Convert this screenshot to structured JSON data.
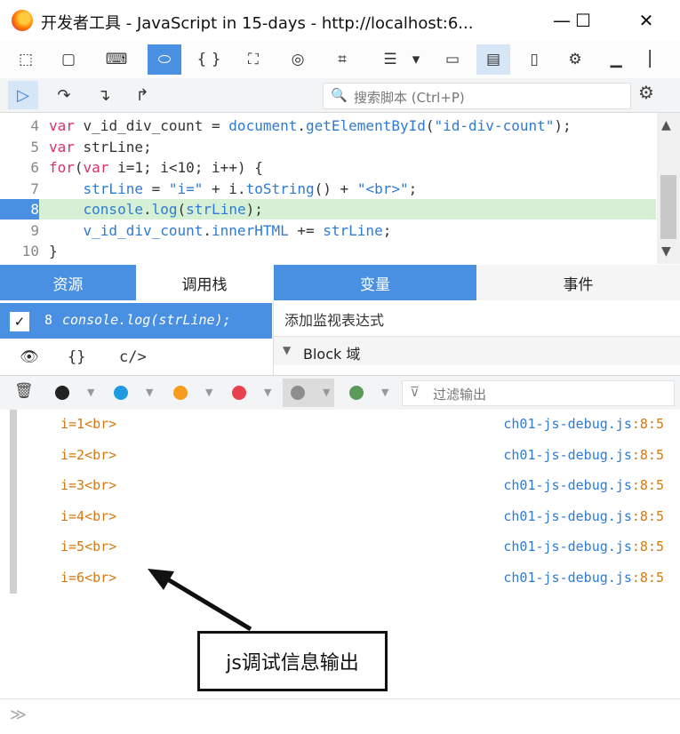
{
  "window": {
    "title": "开发者工具 - JavaScript in 15-days - http://localhost:6...",
    "minimize": "—",
    "maximize": "☐",
    "close": "✕"
  },
  "toolbar": {
    "icons": [
      "pick-element-icon",
      "responsive-icon",
      "console-icon",
      "debugger-icon",
      "style-editor-icon",
      "performance-icon",
      "network-icon",
      "storage-icon",
      "options-icon",
      "more-icon",
      "split-icon",
      "console-split-icon",
      "device-icon",
      "settings-icon",
      "dock-bottom-icon",
      "dock-side-icon"
    ],
    "glyphs": [
      "⬚",
      "▢",
      "⌨",
      "⬭",
      "{ }",
      "⛶",
      "◎",
      "⌗",
      "☰",
      "▾",
      "▭",
      "▤",
      "▯",
      "⚙",
      "▁",
      "▏"
    ]
  },
  "debugger": {
    "resume": "▷",
    "step_over": "↷",
    "step_in": "↴",
    "step_out": "↱",
    "search_placeholder": "搜索脚本 (Ctrl+P)",
    "search_icon": "🔍",
    "gear": "⚙"
  },
  "editor": {
    "lines": [
      {
        "n": "4",
        "parts": [
          [
            "kw",
            "var"
          ],
          [
            "pl",
            " v_id_div_count = "
          ],
          [
            "id",
            "document"
          ],
          [
            "pl",
            "."
          ],
          [
            "fn",
            "getElementById"
          ],
          [
            "pl",
            "("
          ],
          [
            "str",
            "\"id-div-count\""
          ],
          [
            "pl",
            ");"
          ]
        ]
      },
      {
        "n": "5",
        "parts": [
          [
            "kw",
            "var"
          ],
          [
            "pl",
            " strLine;"
          ]
        ]
      },
      {
        "n": "6",
        "parts": [
          [
            "kw",
            "for"
          ],
          [
            "pl",
            "("
          ],
          [
            "kw",
            "var"
          ],
          [
            "pl",
            " i=1; i<10; i++) {"
          ]
        ]
      },
      {
        "n": "7",
        "parts": [
          [
            "pl",
            "    "
          ],
          [
            "id",
            "strLine"
          ],
          [
            "pl",
            " = "
          ],
          [
            "str",
            "\"i=\""
          ],
          [
            "pl",
            " + i."
          ],
          [
            "fn",
            "toString"
          ],
          [
            "pl",
            "() + "
          ],
          [
            "str",
            "\"<br>\""
          ],
          [
            "pl",
            ";"
          ]
        ]
      },
      {
        "n": "8",
        "parts": [
          [
            "pl",
            "    "
          ],
          [
            "id",
            "console"
          ],
          [
            "pl",
            "."
          ],
          [
            "fn",
            "log"
          ],
          [
            "pl",
            "("
          ],
          [
            "id",
            "strLine"
          ],
          [
            "pl",
            ");"
          ]
        ]
      },
      {
        "n": "9",
        "parts": [
          [
            "pl",
            "    "
          ],
          [
            "id",
            "v_id_div_count"
          ],
          [
            "pl",
            "."
          ],
          [
            "fn",
            "innerHTML"
          ],
          [
            "pl",
            " += "
          ],
          [
            "id",
            "strLine"
          ],
          [
            "pl",
            ";"
          ]
        ]
      },
      {
        "n": "10",
        "parts": [
          [
            "pl",
            "}"
          ]
        ]
      }
    ],
    "current_line": "8",
    "scroll_up": "▲",
    "scroll_down": "▼"
  },
  "panes": {
    "tabs": [
      {
        "label": "资源"
      },
      {
        "label": "调用栈"
      },
      {
        "label": "变量"
      },
      {
        "label": "事件"
      }
    ],
    "stack": {
      "checked": "✓",
      "line": "8",
      "code": "console.log(strLine);",
      "eye": "👁",
      "braces": "{}",
      "tag": "c/>"
    },
    "vars": {
      "add_watch": "添加监视表达式",
      "scope_toggle": "▼",
      "scope_label": "Block 域"
    }
  },
  "console": {
    "trash": "🗑",
    "filter_placeholder": "过滤输出",
    "filter_icon": "⊽",
    "level_colors": [
      "#222222",
      "#1e9be0",
      "#f59b1d",
      "#e8414b",
      "#8e8e8e",
      "#5a9a5a"
    ],
    "messages": [
      {
        "text": "i=1<br>",
        "file": "ch01-js-debug.js",
        "pos": ":8:5"
      },
      {
        "text": "i=2<br>",
        "file": "ch01-js-debug.js",
        "pos": ":8:5"
      },
      {
        "text": "i=3<br>",
        "file": "ch01-js-debug.js",
        "pos": ":8:5"
      },
      {
        "text": "i=4<br>",
        "file": "ch01-js-debug.js",
        "pos": ":8:5"
      },
      {
        "text": "i=5<br>",
        "file": "ch01-js-debug.js",
        "pos": ":8:5"
      },
      {
        "text": "i=6<br>",
        "file": "ch01-js-debug.js",
        "pos": ":8:5"
      }
    ],
    "prompt": "≫"
  },
  "annotation": {
    "label": "js调试信息输出"
  }
}
